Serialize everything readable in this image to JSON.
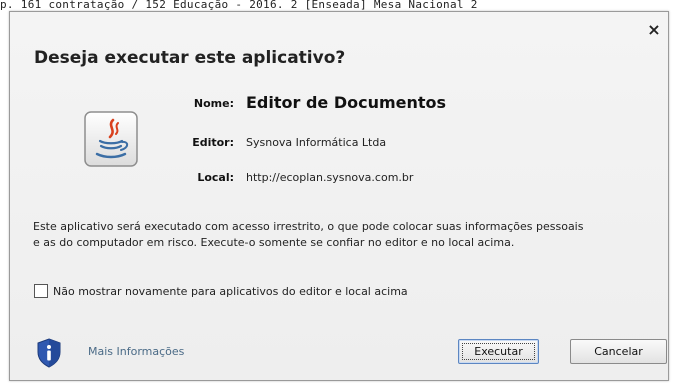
{
  "background": {
    "text": "p. 161 contratação / 152 Educação - 2016. 2 [Enseada] Mesa Nacional 2"
  },
  "dialog": {
    "close_label": "×",
    "title": "Deseja executar este aplicativo?",
    "app_icon": "java-icon",
    "fields": {
      "name_label": "Nome:",
      "name_value": "Editor de Documentos",
      "publisher_label": "Editor:",
      "publisher_value": "Sysnova Informática Ltda",
      "location_label": "Local:",
      "location_value": "http://ecoplan.sysnova.com.br"
    },
    "warning_line1": "Este aplicativo será executado com acesso irrestrito, o que pode colocar suas informações pessoais",
    "warning_line2": "e as do computador em risco. Execute-o somente se confiar no editor e no local acima.",
    "checkbox": {
      "label": "Não mostrar novamente para aplicativos do editor e local acima",
      "checked": false
    },
    "info_icon": "shield-info-icon",
    "more_info_label": "Mais Informações",
    "run_button": "Executar",
    "cancel_button": "Cancelar"
  },
  "colors": {
    "dialog_bg": "#f0f0f0",
    "link": "#4a6a86",
    "shield": "#2f58b0",
    "java_red": "#d9411e",
    "java_blue": "#3b6ea5"
  }
}
